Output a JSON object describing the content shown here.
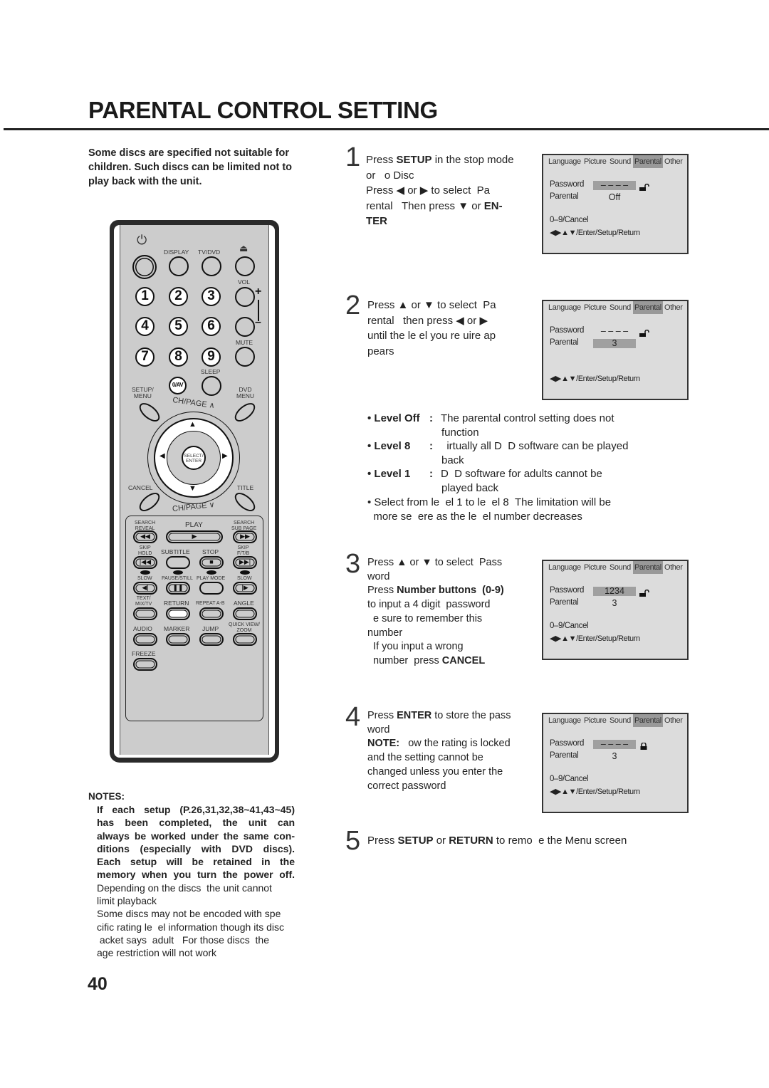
{
  "page": {
    "title": "PARENTAL CONTROL SETTING",
    "intro": "Some discs are specified not suitable for children. Such discs can be limited not to play back with the unit.",
    "page_number": "40"
  },
  "remote": {
    "labels": {
      "power": "⏻",
      "display": "DISPLAY",
      "tvdvd": "TV/DVD",
      "eject": "⏏",
      "vol": "VOL",
      "plus": "+",
      "minus": "–",
      "mute": "MUTE",
      "sleep": "SLEEP",
      "zero_av": "0/AV",
      "setup_menu": "SETUP/\nMENU",
      "dvd_menu": "DVD\nMENU",
      "ch_page_up": "CH/PAGE ∧",
      "ch_page_down": "CH/PAGE ∨",
      "select_enter": "SELECT/\nENTER",
      "cancel": "CANCEL",
      "title": "TITLE",
      "search_reveal": "SEARCH\nREVEAL",
      "play": "PLAY",
      "search_sub_page": "SEARCH\nSUB PAGE",
      "skip_hold": "SKIP\nHOLD",
      "subtitle": "SUBTITLE",
      "stop": "STOP",
      "skip_ftb": "SKIP\nF/T/B",
      "slow_l": "SLOW",
      "pause_still": "PAUSE/STILL",
      "play_mode": "PLAY MODE",
      "slow_r": "SLOW",
      "text_mix_tv": "TEXT/\nMIX/TV",
      "return": "RETURN",
      "repeat_ab": "REPEAT A-B",
      "angle": "ANGLE",
      "audio": "AUDIO",
      "marker": "MARKER",
      "jump": "JUMP",
      "quick_view_zoom": "QUICK VIEW/\nZOOM",
      "freeze": "FREEZE"
    },
    "numbers": [
      "1",
      "2",
      "3",
      "4",
      "5",
      "6",
      "7",
      "8",
      "9"
    ],
    "glyphs": {
      "rew": "◀◀",
      "play": "▶",
      "ff": "▶▶",
      "prev": "|◀◀",
      "stop": "■",
      "next": "▶▶|",
      "slow_back": "◀|",
      "pause": "❚❚",
      "slow_fwd": "|▶",
      "up": "▲",
      "down": "▼",
      "left": "◀",
      "right": "▶"
    }
  },
  "steps": [
    {
      "num": "1",
      "lines": [
        "Press <b>SETUP</b> in the stop mode",
        "or &nbsp;&nbsp;o Disc",
        "Press ◀ or ▶ to select &nbsp;Pa",
        "rental &nbsp;&nbsp;Then press ▼ or <b>EN-</b>",
        "<b>TER</b>"
      ]
    },
    {
      "num": "2",
      "lines": [
        "Press ▲ or ▼ to select &nbsp;Pa",
        "rental &nbsp;&nbsp;then press ◀ or ▶",
        "until the le el you re uire ap",
        "pears"
      ]
    },
    {
      "num": "3",
      "lines": [
        "Press ▲ or ▼ to select &nbsp;Pass",
        "word",
        "Press <b>Number buttons &nbsp;(0-9)</b>",
        "to input a 4 digit &nbsp;password",
        "&nbsp;&nbsp;e sure to remember this",
        "number",
        "&nbsp;&nbsp;If you input a wrong",
        "&nbsp;&nbsp;number &nbsp;press <b>CANCEL</b>"
      ]
    },
    {
      "num": "4",
      "lines": [
        "Press <b>ENTER</b> to store the pass",
        "word",
        "<b>NOTE:</b> &nbsp;&nbsp;ow the rating is locked",
        "and the setting cannot be",
        "changed unless you enter the",
        "correct password"
      ]
    },
    {
      "num": "5",
      "lines": [
        "Press <b>SETUP</b> or <b>RETURN</b> to remo &nbsp;e the Menu screen"
      ]
    }
  ],
  "screens": [
    {
      "tabs": [
        "Language",
        "Picture",
        "Sound",
        "Parental",
        "Other"
      ],
      "active_tab": "Parental",
      "password_label": "Password",
      "password_value": "– – – –",
      "password_highlighted": true,
      "lock": "unlocked",
      "parental_label": "Parental",
      "parental_value": "Off",
      "parental_highlighted": false,
      "hint1": "0–9/Cancel",
      "hint2": "◀▶▲▼/Enter/Setup/Return"
    },
    {
      "tabs": [
        "Language",
        "Picture",
        "Sound",
        "Parental",
        "Other"
      ],
      "active_tab": "Parental",
      "password_label": "Password",
      "password_value": "– – – –",
      "password_highlighted": false,
      "lock": "unlocked",
      "parental_label": "Parental",
      "parental_value": "3",
      "parental_highlighted": true,
      "hint1": "",
      "hint2": "◀▶▲▼/Enter/Setup/Return"
    },
    {
      "tabs": [
        "Language",
        "Picture",
        "Sound",
        "Parental",
        "Other"
      ],
      "active_tab": "Parental",
      "password_label": "Password",
      "password_value": "1234",
      "password_highlighted": true,
      "lock": "unlocked",
      "parental_label": "Parental",
      "parental_value": "3",
      "parental_highlighted": false,
      "hint1": "0–9/Cancel",
      "hint2": "◀▶▲▼/Enter/Setup/Return"
    },
    {
      "tabs": [
        "Language",
        "Picture",
        "Sound",
        "Parental",
        "Other"
      ],
      "active_tab": "Parental",
      "password_label": "Password",
      "password_value": "– – – –",
      "password_highlighted": true,
      "lock": "locked",
      "parental_label": "Parental",
      "parental_value": "3",
      "parental_highlighted": false,
      "hint1": "0–9/Cancel",
      "hint2": "◀▶▲▼/Enter/Setup/Return"
    }
  ],
  "levels": [
    {
      "label": "• Level Off",
      "colon": ":",
      "desc": "The parental control setting does not",
      "desc2": "function"
    },
    {
      "label": "• Level 8",
      "colon": ":",
      "desc": "&nbsp;&nbsp;irtually all D &nbsp;D software can be played",
      "desc2": "back"
    },
    {
      "label": "• Level 1",
      "colon": ":",
      "desc": "D &nbsp;D software for adults cannot be",
      "desc2": "played back"
    }
  ],
  "select_note": [
    "• Select from le &nbsp;el 1 to le &nbsp;el 8 &nbsp;The limitation will be",
    "&nbsp;&nbsp;more se &nbsp;ere as the le &nbsp;el number decreases"
  ],
  "notes": {
    "heading": "NOTES:",
    "bold_lines": [
      "If each setup (P.26,31,32,38~41,43~45)",
      "has been completed, the unit can",
      "always be worked under the same con-",
      "ditions (especially with DVD discs).",
      "Each setup will be retained in the",
      "memory when you turn the power off."
    ],
    "lines": [
      "Depending on the discs &nbsp;the unit cannot",
      "limit playback",
      "Some discs may not be encoded with spe",
      "cific rating le &nbsp;el information though its disc",
      "&nbsp;acket says &nbsp;adult &nbsp;&nbsp;For those discs &nbsp;the",
      "age restriction will not work"
    ]
  }
}
